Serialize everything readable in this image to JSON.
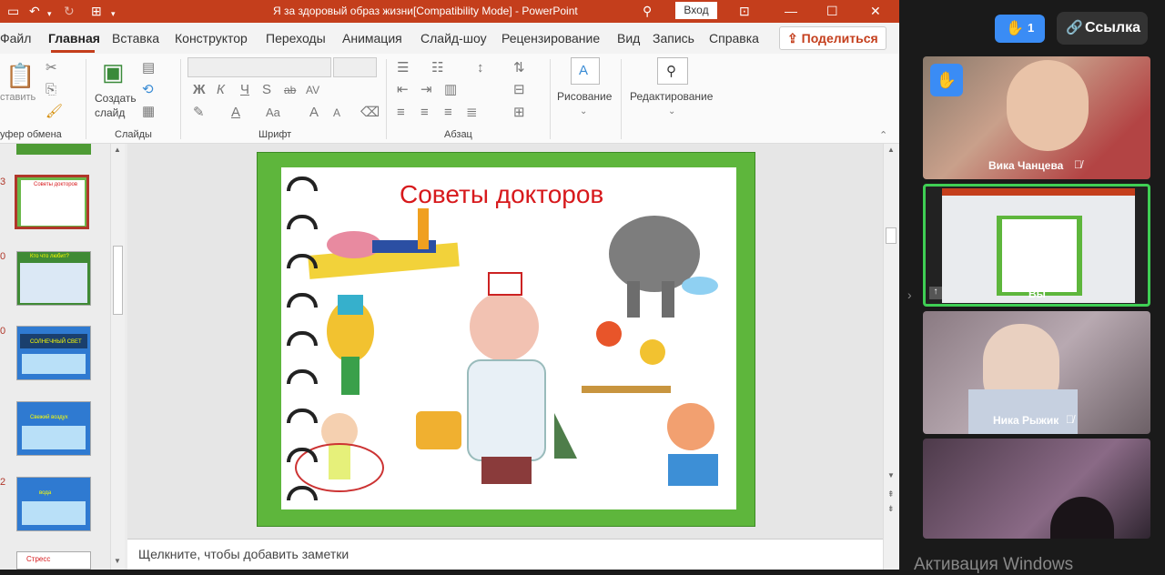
{
  "titlebar": {
    "document_title": "Я за здоровый образ жизни[Compatibility Mode]  -  PowerPoint",
    "login_label": "Вход"
  },
  "tabs": [
    "Файл",
    "Главная",
    "Вставка",
    "Конструктор",
    "Переходы",
    "Анимация",
    "Слайд-шоу",
    "Рецензирование",
    "Вид",
    "Запись",
    "Справка"
  ],
  "active_tab": "Главная",
  "share_label": "Поделиться",
  "ribbon": {
    "clipboard": {
      "paste_label": "ставить",
      "group_label": "уфер обмена"
    },
    "slides": {
      "new_slide_label_1": "Создать",
      "new_slide_label_2": "слайд",
      "group_label": "Слайды"
    },
    "font": {
      "group_label": "Шрифт",
      "buttons": [
        "Ж",
        "К",
        "Ч",
        "S",
        "ab",
        "AV",
        "A",
        "Aa",
        "A",
        "A"
      ]
    },
    "paragraph": {
      "group_label": "Абзац"
    },
    "drawing": {
      "label": "Рисование"
    },
    "editing": {
      "label": "Редактирование"
    }
  },
  "slide_numbers": [
    "3",
    "0",
    "0",
    "2"
  ],
  "thumbs": [
    {
      "title": "Советы докторов"
    },
    {
      "title": "Кто что любит?"
    },
    {
      "title": "СОЛНЕЧНЫЙ СВЕТ"
    },
    {
      "title": "Свежий воздух"
    },
    {
      "title": "вода"
    },
    {
      "title": "Стресс"
    }
  ],
  "slide": {
    "title": "Советы докторов"
  },
  "notes_placeholder": "Щелкните, чтобы добавить заметки",
  "zoom": {
    "raised_hands_count": "1",
    "link_label": "Ссылка",
    "participants": [
      {
        "name": "Вика Чанцева",
        "muted": true,
        "hand_raised": true
      },
      {
        "name": "Вы",
        "muted": false,
        "active_speaker": true
      },
      {
        "name": "Ника Рыжик",
        "muted": true
      },
      {
        "name": "",
        "muted": false
      }
    ],
    "accent_color": "#3a8cf5",
    "active_border_color": "#3fcf54"
  },
  "watermark": "Активация Windows"
}
